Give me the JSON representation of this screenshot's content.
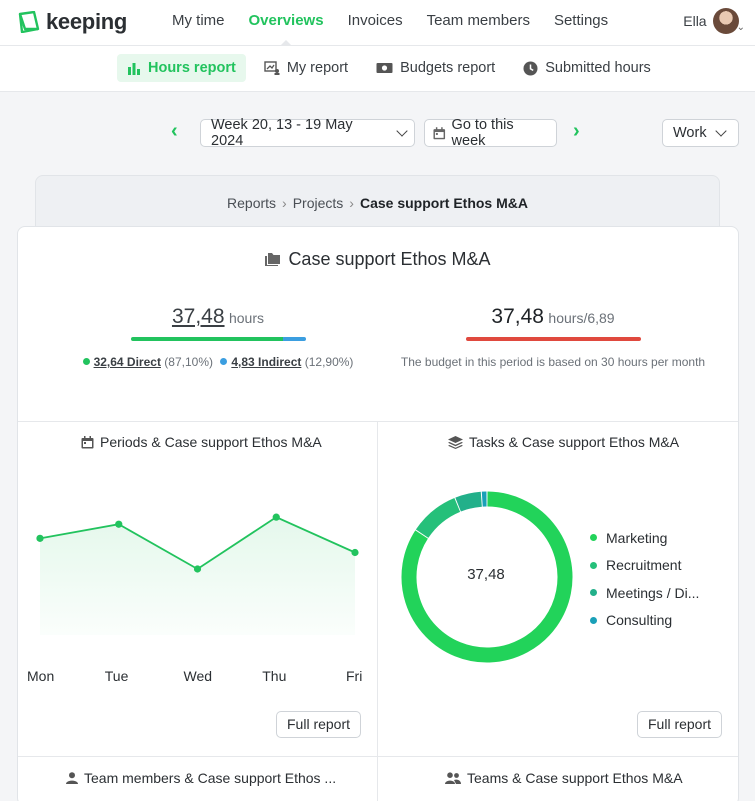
{
  "app": {
    "logo_text": "keeping",
    "user_name": "Ella"
  },
  "nav": {
    "items": [
      {
        "label": "My time",
        "active": false
      },
      {
        "label": "Overviews",
        "active": true
      },
      {
        "label": "Invoices",
        "active": false
      },
      {
        "label": "Team members",
        "active": false
      },
      {
        "label": "Settings",
        "active": false
      }
    ]
  },
  "subnav": {
    "items": [
      {
        "label": "Hours report",
        "icon": "bar-chart-icon",
        "active": true
      },
      {
        "label": "My report",
        "icon": "person-chart-icon",
        "active": false
      },
      {
        "label": "Budgets report",
        "icon": "money-icon",
        "active": false
      },
      {
        "label": "Submitted hours",
        "icon": "clock-icon",
        "active": false
      }
    ]
  },
  "period": {
    "week_label": "Week 20, 13 - 19 May 2024",
    "goto_label": "Go to this week",
    "filter_label": "Work"
  },
  "breadcrumb": {
    "items": [
      "Reports",
      "Projects",
      "Case support Ethos M&A"
    ]
  },
  "report": {
    "title": "Case support Ethos M&A",
    "hours_value": "37,48",
    "hours_unit": "hours",
    "direct_label": "32,64 Direct",
    "direct_pct": "(87,10%)",
    "indirect_label": "4,83 Indirect",
    "indirect_pct": "(12,90%)",
    "direct_fraction": 0.871,
    "budget_value": "37,48",
    "budget_unit": "hours/6,89",
    "budget_note": "The budget in this period is based on 30 hours per month",
    "colors": {
      "direct": "#22c35e",
      "indirect": "#3b9ee0",
      "budget": "#e0493e"
    }
  },
  "periods_panel": {
    "title": "Periods & Case support Ethos M&A",
    "full_report": "Full report"
  },
  "tasks_panel": {
    "title": "Tasks & Case support Ethos M&A",
    "full_report": "Full report",
    "center_label": "37,48"
  },
  "bottom_panels": {
    "team_title": "Team members & Case support Ethos ...",
    "teams_title": "Teams & Case support Ethos M&A"
  },
  "chart_data": [
    {
      "type": "line",
      "categories": [
        "Mon",
        "Tue",
        "Wed",
        "Thu",
        "Fri"
      ],
      "values": [
        8.2,
        9.4,
        5.6,
        10.0,
        7.0
      ],
      "ylim": [
        0,
        14
      ],
      "grid": false,
      "color": "#22c35e"
    },
    {
      "type": "pie",
      "labels": [
        "Marketing",
        "Recruitment",
        "Meetings / Di...",
        "Consulting"
      ],
      "values": [
        31.6,
        3.6,
        1.9,
        0.4
      ],
      "colors": [
        "#22d35a",
        "#25c07a",
        "#22b08a",
        "#1aa0b8"
      ],
      "center_label": "37,48"
    }
  ]
}
